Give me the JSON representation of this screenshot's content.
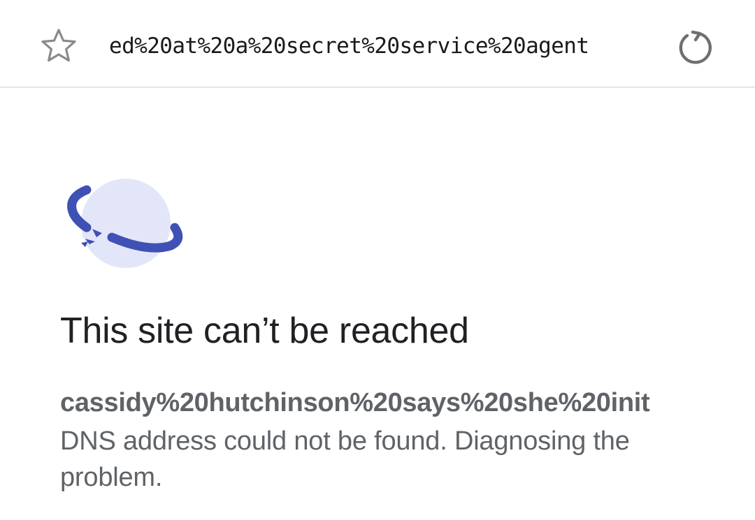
{
  "address_bar": {
    "url_text": "ed%20at%20a%20secret%20service%20agent",
    "bookmark_icon": "star-outline-icon",
    "reload_icon": "reload-icon"
  },
  "error_page": {
    "illustration_icon": "disconnected-planet-icon",
    "title": "This site can’t be reached",
    "host": "cassidy%20hutchinson%20says%20she%20init",
    "description": "DNS address could not be found. Diagnosing the problem."
  },
  "colors": {
    "accent": "#3f51b5",
    "planet": "#e3e6f8",
    "title_text": "#202124",
    "body_text": "#5f6368",
    "divider": "#e6e6e6"
  }
}
